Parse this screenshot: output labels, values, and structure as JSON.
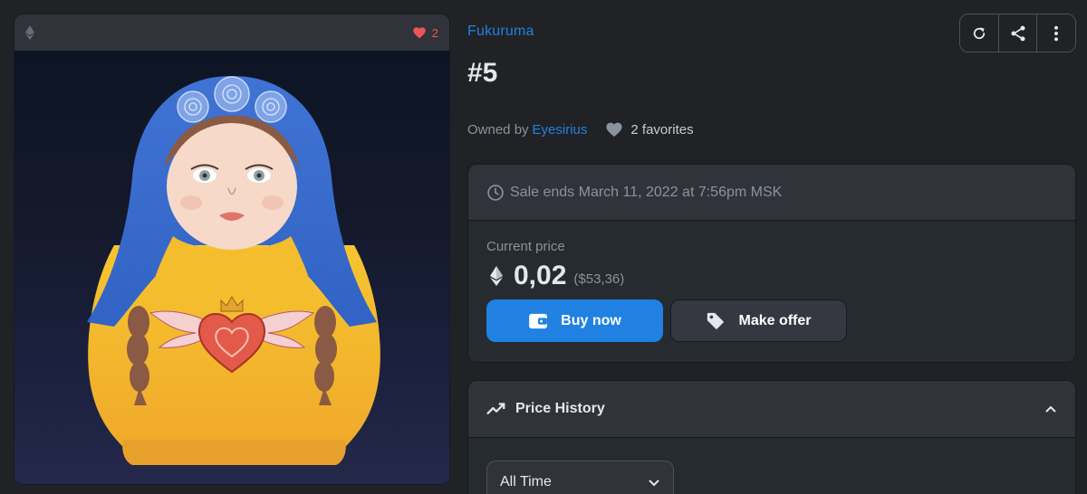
{
  "media": {
    "favorites_count": "2",
    "chain_icon": "ethereum-icon",
    "heart_color": "#eb5757"
  },
  "item": {
    "collection": "Fukuruma",
    "title": "#5",
    "owned_by_label": "Owned by",
    "owner": "Eyesirius",
    "favorites": "2 favorites"
  },
  "toolbar": {
    "icons": [
      "refresh-icon",
      "share-icon",
      "more-icon"
    ]
  },
  "sale": {
    "ends_text": "Sale ends March 11, 2022 at 7:56pm MSK",
    "current_price_label": "Current price",
    "price": "0,02",
    "price_usd": "($53,36)",
    "buy_label": "Buy now",
    "offer_label": "Make offer"
  },
  "history": {
    "title": "Price History",
    "range_selected": "All Time"
  },
  "colors": {
    "accent": "#2081e2",
    "background": "#202225",
    "panel": "#303339"
  }
}
